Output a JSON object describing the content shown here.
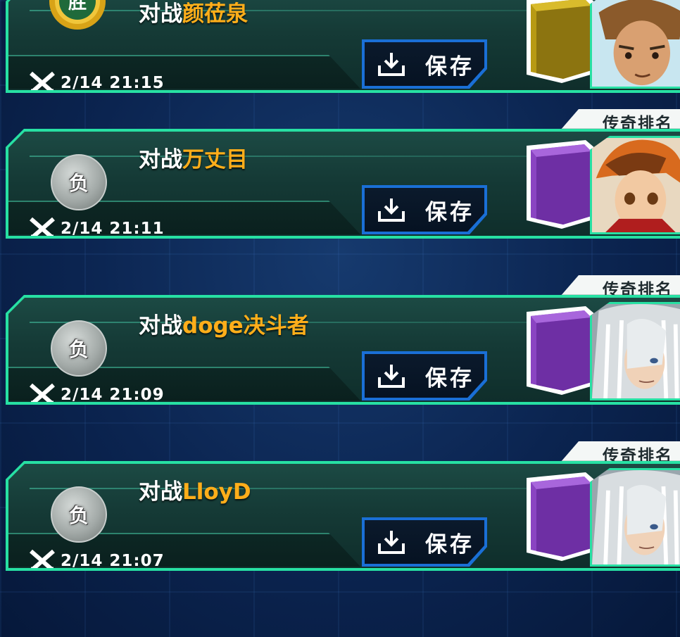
{
  "records": [
    {
      "rank_label": "",
      "result": "胜",
      "win": true,
      "title_prefix": "对战",
      "opponent": "颜莅泉",
      "save_label": "保存",
      "timestamp": "2/14 21:15",
      "deck_color": "#b89a14",
      "avatar": "brown-hair-duelist-avatar"
    },
    {
      "rank_label": "传奇排名",
      "result": "负",
      "win": false,
      "title_prefix": "对战",
      "opponent": "万丈目",
      "save_label": "保存",
      "timestamp": "2/14 21:11",
      "deck_color": "#8a44c2",
      "avatar": "jaden-avatar"
    },
    {
      "rank_label": "传奇排名",
      "result": "负",
      "win": false,
      "title_prefix": "对战",
      "opponent": "doge决斗者",
      "save_label": "保存",
      "timestamp": "2/14 21:09",
      "deck_color": "#8a44c2",
      "avatar": "pegasus-avatar"
    },
    {
      "rank_label": "传奇排名",
      "result": "负",
      "win": false,
      "title_prefix": "对战",
      "opponent": "LloyD",
      "save_label": "保存",
      "timestamp": "2/14 21:07",
      "deck_color": "#8a44c2",
      "avatar": "pegasus-avatar"
    }
  ],
  "colors": {
    "panel_border": "#27e0a3",
    "opponent_name": "#ffae1a",
    "save_border": "#1a6fd6"
  }
}
